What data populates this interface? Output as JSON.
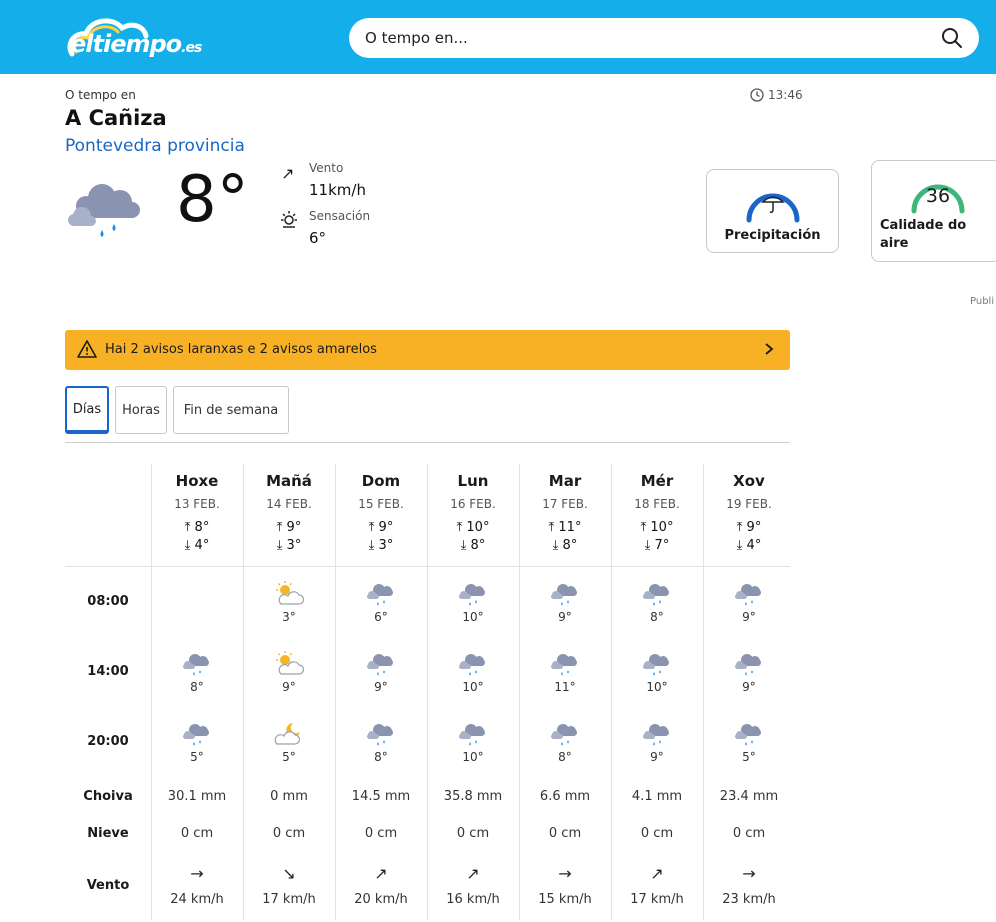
{
  "header": {
    "logo_main": "eltiempo",
    "logo_suffix": ".es",
    "search_placeholder": "O tempo en..."
  },
  "location": {
    "small_label": "O tempo en",
    "city": "A Cañiza",
    "province": "Pontevedra provincia",
    "time": "13:46"
  },
  "current": {
    "temperature": "8°",
    "wind_label": "Vento",
    "wind_value": "11km/h",
    "sensation_label": "Sensación",
    "sensation_value": "6°"
  },
  "cards": {
    "precip_label": "Precipitación",
    "air_value": "36",
    "air_label": "Calidade do aire",
    "accent_blue": "#1a66c8",
    "accent_green": "#3fb57c"
  },
  "ad_label": "Publi",
  "alert": {
    "text": "Hai 2 avisos laranxas e 2 avisos amarelos",
    "color": "#f8b124"
  },
  "tabs": [
    {
      "label": "Días",
      "active": true
    },
    {
      "label": "Horas",
      "active": false
    },
    {
      "label": "Fin de semana",
      "active": false
    }
  ],
  "row_labels": {
    "h08": "08:00",
    "h14": "14:00",
    "h20": "20:00",
    "rain": "Choiva",
    "snow": "Nieve",
    "wind": "Vento"
  },
  "days": [
    {
      "name": "Hoxe",
      "date": "13 FEB.",
      "max": "8°",
      "min": "4°",
      "h08": {
        "icon": "",
        "temp": ""
      },
      "h14": {
        "icon": "rain",
        "temp": "8°"
      },
      "h20": {
        "icon": "rain",
        "temp": "5°"
      },
      "rain": "30.1 mm",
      "snow": "0 cm",
      "wind_dir": "→",
      "wind": "24 km/h"
    },
    {
      "name": "Mañá",
      "date": "14 FEB.",
      "max": "9°",
      "min": "3°",
      "h08": {
        "icon": "sun-cloud",
        "temp": "3°"
      },
      "h14": {
        "icon": "sun-cloud",
        "temp": "9°"
      },
      "h20": {
        "icon": "moon-cloud",
        "temp": "5°"
      },
      "rain": "0 mm",
      "snow": "0 cm",
      "wind_dir": "↘",
      "wind": "17 km/h"
    },
    {
      "name": "Dom",
      "date": "15 FEB.",
      "max": "9°",
      "min": "3°",
      "h08": {
        "icon": "rain",
        "temp": "6°"
      },
      "h14": {
        "icon": "rain",
        "temp": "9°"
      },
      "h20": {
        "icon": "rain",
        "temp": "8°"
      },
      "rain": "14.5 mm",
      "snow": "0 cm",
      "wind_dir": "↗",
      "wind": "20 km/h"
    },
    {
      "name": "Lun",
      "date": "16 FEB.",
      "max": "10°",
      "min": "8°",
      "h08": {
        "icon": "rain",
        "temp": "10°"
      },
      "h14": {
        "icon": "rain",
        "temp": "10°"
      },
      "h20": {
        "icon": "rain",
        "temp": "10°"
      },
      "rain": "35.8 mm",
      "snow": "0 cm",
      "wind_dir": "↗",
      "wind": "16 km/h"
    },
    {
      "name": "Mar",
      "date": "17 FEB.",
      "max": "11°",
      "min": "8°",
      "h08": {
        "icon": "rain",
        "temp": "9°"
      },
      "h14": {
        "icon": "rain",
        "temp": "11°"
      },
      "h20": {
        "icon": "rain",
        "temp": "8°"
      },
      "rain": "6.6 mm",
      "snow": "0 cm",
      "wind_dir": "→",
      "wind": "15 km/h"
    },
    {
      "name": "Mér",
      "date": "18 FEB.",
      "max": "10°",
      "min": "7°",
      "h08": {
        "icon": "rain",
        "temp": "8°"
      },
      "h14": {
        "icon": "rain",
        "temp": "10°"
      },
      "h20": {
        "icon": "rain",
        "temp": "9°"
      },
      "rain": "4.1 mm",
      "snow": "0 cm",
      "wind_dir": "↗",
      "wind": "17 km/h"
    },
    {
      "name": "Xov",
      "date": "19 FEB.",
      "max": "9°",
      "min": "4°",
      "h08": {
        "icon": "rain",
        "temp": "9°"
      },
      "h14": {
        "icon": "rain",
        "temp": "9°"
      },
      "h20": {
        "icon": "rain",
        "temp": "5°"
      },
      "rain": "23.4 mm",
      "snow": "0 cm",
      "wind_dir": "→",
      "wind": "23 km/h"
    }
  ]
}
